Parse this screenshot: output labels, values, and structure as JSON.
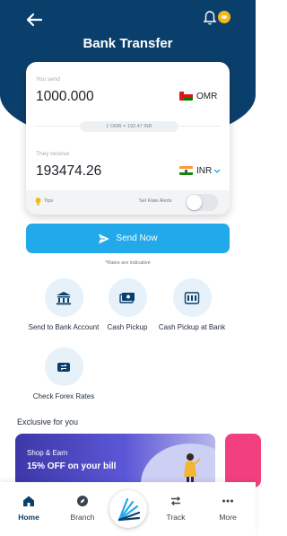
{
  "header": {
    "title": "Bank Transfer",
    "back_icon": "arrow-left-icon",
    "notification_icon": "bell-icon",
    "chat_icon": "chat-bubble-icon"
  },
  "transfer_card": {
    "send_label": "You send",
    "send_amount": "1000.000",
    "send_currency": "OMR",
    "rate_text": "1 OMR = 192.47 INR",
    "receive_label": "They receive",
    "receive_amount": "193474.26",
    "receive_currency": "INR",
    "tips_label": "Tips",
    "rate_alerts_label": "Set Rate Alerts",
    "rate_alerts_on": false
  },
  "send_button": {
    "label": "Send Now"
  },
  "note": "*Rates are indicative",
  "services": [
    {
      "label": "Send to Bank Account",
      "icon": "bank-icon"
    },
    {
      "label": "Cash Pickup",
      "icon": "cash-icon"
    },
    {
      "label": "Cash Pickup at Bank",
      "icon": "bank-cash-icon"
    },
    {
      "label": "Check Forex Rates",
      "icon": "forex-icon"
    }
  ],
  "exclusive": {
    "title": "Exclusive for you",
    "promo_line1": "Shop & Earn",
    "promo_line2": "15% OFF on your bill"
  },
  "nav": {
    "items": [
      {
        "label": "Home",
        "icon": "home-icon",
        "active": true
      },
      {
        "label": "Branch",
        "icon": "compass-icon",
        "active": false
      },
      {
        "label": "Track",
        "icon": "swap-arrows-icon",
        "active": false
      },
      {
        "label": "More",
        "icon": "dots-icon",
        "active": false
      }
    ],
    "center_icon": "logo-icon"
  },
  "colors": {
    "header_bg": "#0b3f6b",
    "accent": "#21a9ea",
    "service_circle": "#e6f1fa"
  }
}
